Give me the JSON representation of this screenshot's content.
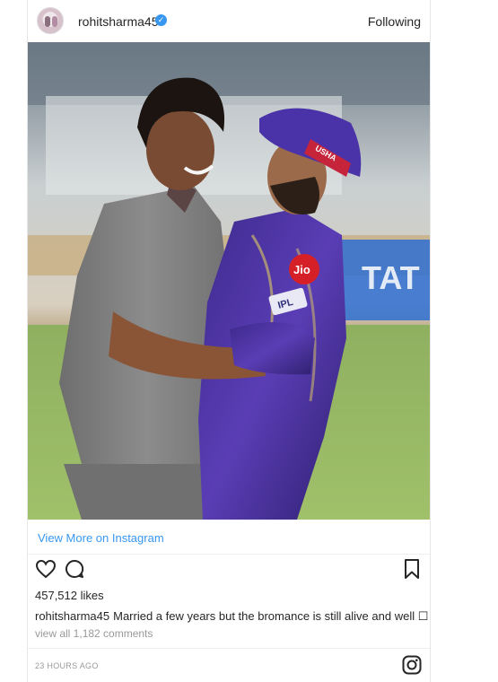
{
  "post": {
    "username": "rohitsharma45",
    "verified_icon": "verified-badge-icon",
    "follow_status": "Following",
    "photo": {
      "jersey_sponsor": "Jio",
      "jersey_badge": "IPL",
      "cap_text": "USHA",
      "board_text": "TAT"
    },
    "view_more": "View More on Instagram",
    "likes": "457,512 likes",
    "caption_user": "rohitsharma45",
    "caption_text": "Married a few years but the bromance is still alive and well ☐",
    "comments_link": "view all 1,182 comments",
    "timestamp": "23 HOURS AGO"
  },
  "colors": {
    "link": "#3897f0",
    "verified": "#3897f0",
    "text": "#262626",
    "muted": "#999999"
  }
}
